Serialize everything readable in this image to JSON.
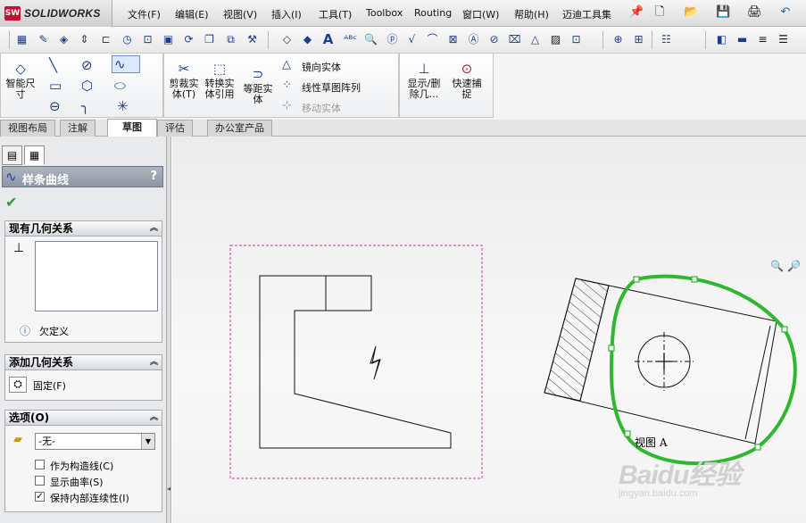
{
  "app": {
    "logo_text": "SOLIDWORKS",
    "logo_badge": "SW"
  },
  "menu": {
    "items": [
      "文件(F)",
      "编辑(E)",
      "视图(V)",
      "插入(I)",
      "工具(T)",
      "Toolbox",
      "Routing",
      "窗口(W)",
      "帮助(H)",
      "迈迪工具集"
    ]
  },
  "ribbon": {
    "smart_dimension": "智能尺寸",
    "trim": "剪裁实体(T)",
    "convert": "转换实体引用",
    "offset": "等距实体",
    "mirror": "镜向实体",
    "linear_pattern": "线性草图阵列",
    "move": "移动实体",
    "show_delete": "显示/删除几...",
    "quick_snap": "快速捕捉"
  },
  "tabs": [
    "视图布局",
    "注解",
    "草图",
    "评估",
    "办公室产品"
  ],
  "active_tab": "草图",
  "property_manager": {
    "title": "样条曲线",
    "help": "?",
    "existing_relations": {
      "header": "现有几何关系",
      "status": "欠定义"
    },
    "add_relations": {
      "header": "添加几何关系",
      "fix": "固定(F)"
    },
    "options": {
      "header": "选项(O)",
      "combo_value": "-无-",
      "construction": {
        "label": "作为构造线(C)",
        "checked": false
      },
      "show_curvature": {
        "label": "显示曲率(S)",
        "checked": false
      },
      "keep_continuity": {
        "label": "保持内部连续性(I)",
        "checked": true
      }
    }
  },
  "canvas": {
    "view_label": "视图 A",
    "spline_color": "#2db82d",
    "view_border_color": "#d4379c"
  },
  "watermark": {
    "brand": "Baidu经验",
    "url": "jingyan.baidu.com"
  }
}
